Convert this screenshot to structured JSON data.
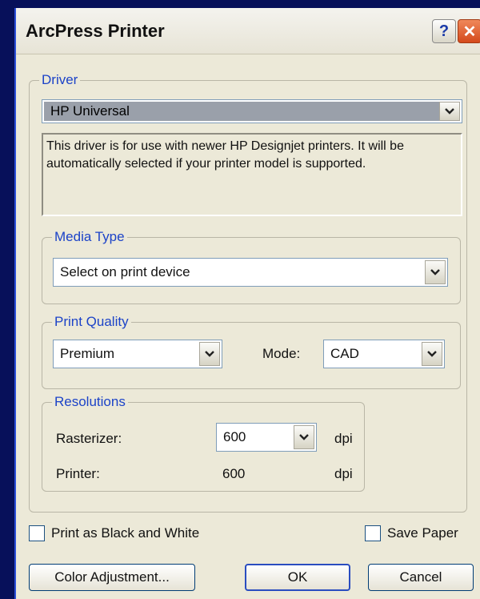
{
  "window": {
    "title": "ArcPress Printer",
    "help_label": "?",
    "close_label": "✕"
  },
  "driver": {
    "group_label": "Driver",
    "selected": "HP Universal",
    "description": "This driver is for use with newer HP Designjet printers. It will be automatically selected if your printer model is supported."
  },
  "media_type": {
    "group_label": "Media Type",
    "selected": "Select on print device"
  },
  "print_quality": {
    "group_label": "Print Quality",
    "quality_selected": "Premium",
    "mode_label": "Mode:",
    "mode_selected": "CAD"
  },
  "resolutions": {
    "group_label": "Resolutions",
    "rasterizer_label": "Rasterizer:",
    "rasterizer_value": "600",
    "rasterizer_unit": "dpi",
    "printer_label": "Printer:",
    "printer_value": "600",
    "printer_unit": "dpi"
  },
  "options": {
    "black_white_label": "Print as Black and White",
    "save_paper_label": "Save Paper"
  },
  "buttons": {
    "color_adjustment": "Color Adjustment...",
    "ok": "OK",
    "cancel": "Cancel"
  },
  "icons": {
    "dropdown": "chevron-down-icon",
    "help": "question-icon",
    "close": "close-icon"
  }
}
